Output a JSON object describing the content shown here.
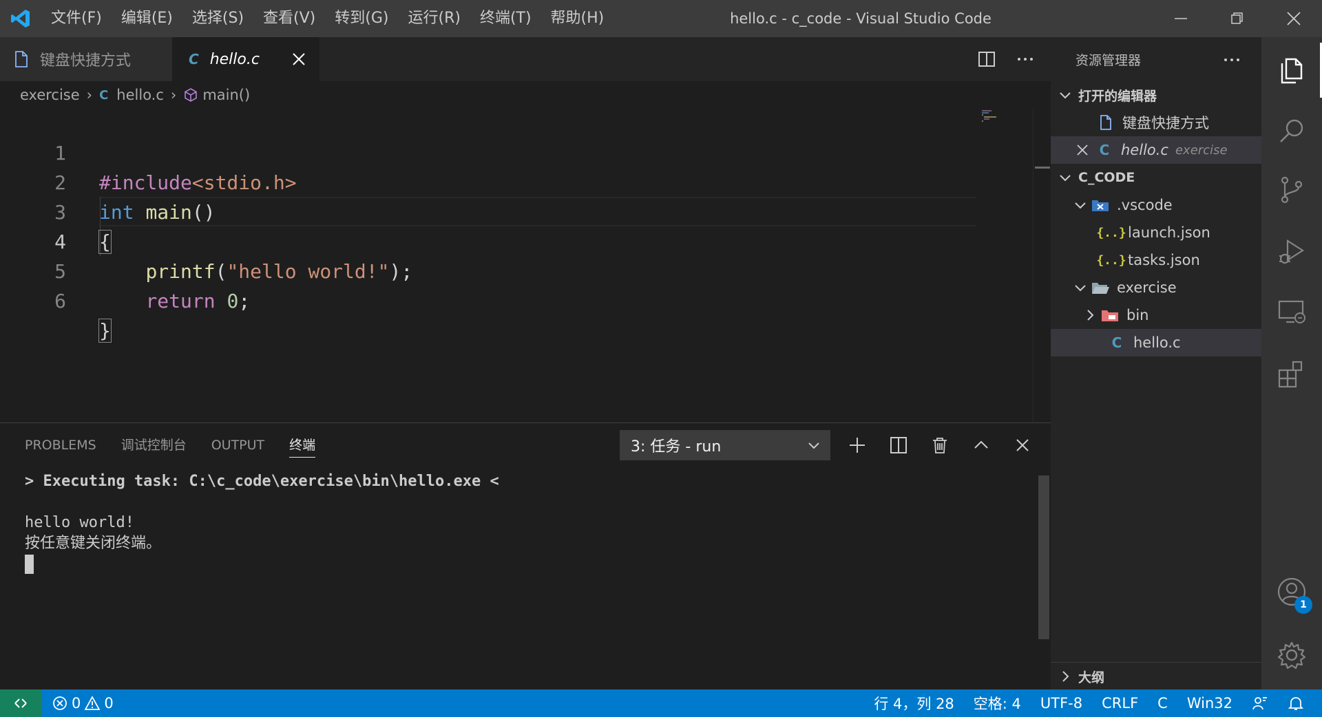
{
  "titlebar": {
    "menu": [
      "文件(F)",
      "编辑(E)",
      "选择(S)",
      "查看(V)",
      "转到(G)",
      "运行(R)",
      "终端(T)",
      "帮助(H)"
    ],
    "title": "hello.c - c_code - Visual Studio Code"
  },
  "tabs": [
    {
      "label": "键盘快捷方式",
      "icon": "file-icon",
      "active": false
    },
    {
      "label": "hello.c",
      "icon": "c-file-icon",
      "active": true
    }
  ],
  "breadcrumb": {
    "folder": "exercise",
    "file": "hello.c",
    "symbol": "main()"
  },
  "editor": {
    "line_numbers": [
      "1",
      "2",
      "3",
      "4",
      "5",
      "6"
    ],
    "active_line": 4,
    "lines": {
      "l1": {
        "pre": "#include",
        "inc": "<stdio.h>"
      },
      "l2": {
        "kw": "int",
        "fn": "main",
        "pun": "()"
      },
      "l3": {
        "pun": "{"
      },
      "l4": {
        "fn": "printf",
        "open": "(",
        "str": "\"hello world!\"",
        "close": ");"
      },
      "l5": {
        "kw": "return",
        "num": "0",
        "pun": ";"
      },
      "l6": {
        "pun": "}"
      }
    }
  },
  "panel": {
    "tabs": [
      "PROBLEMS",
      "调试控制台",
      "OUTPUT",
      "终端"
    ],
    "active_tab": "终端",
    "terminal_select": "3: 任务 - run",
    "terminal": {
      "task_line": "> Executing task: C:\\c_code\\exercise\\bin\\hello.exe <",
      "output_line": "hello world!",
      "prompt_line": "按任意键关闭终端。"
    }
  },
  "sidebar": {
    "title": "资源管理器",
    "open_editors": {
      "header": "打开的编辑器",
      "items": [
        {
          "label": "键盘快捷方式",
          "detail": ""
        },
        {
          "label": "hello.c",
          "detail": "exercise"
        }
      ]
    },
    "workspace": {
      "header": "C_CODE",
      "items": [
        {
          "label": ".vscode",
          "type": "folder-open"
        },
        {
          "label": "launch.json",
          "type": "json"
        },
        {
          "label": "tasks.json",
          "type": "json"
        },
        {
          "label": "exercise",
          "type": "folder-open"
        },
        {
          "label": "bin",
          "type": "folder-closed"
        },
        {
          "label": "hello.c",
          "type": "c"
        }
      ]
    },
    "outline_header": "大纲"
  },
  "activity": {
    "accounts_badge": "1"
  },
  "statusbar": {
    "errors": "0",
    "warnings": "0",
    "position": "行 4，列 28",
    "spaces": "空格: 4",
    "encoding": "UTF-8",
    "eol": "CRLF",
    "language": "C",
    "platform": "Win32"
  },
  "colors": {
    "accent": "#007acc",
    "remote": "#16825d",
    "c_icon": "#519aba",
    "json_icon": "#cbcb41"
  }
}
